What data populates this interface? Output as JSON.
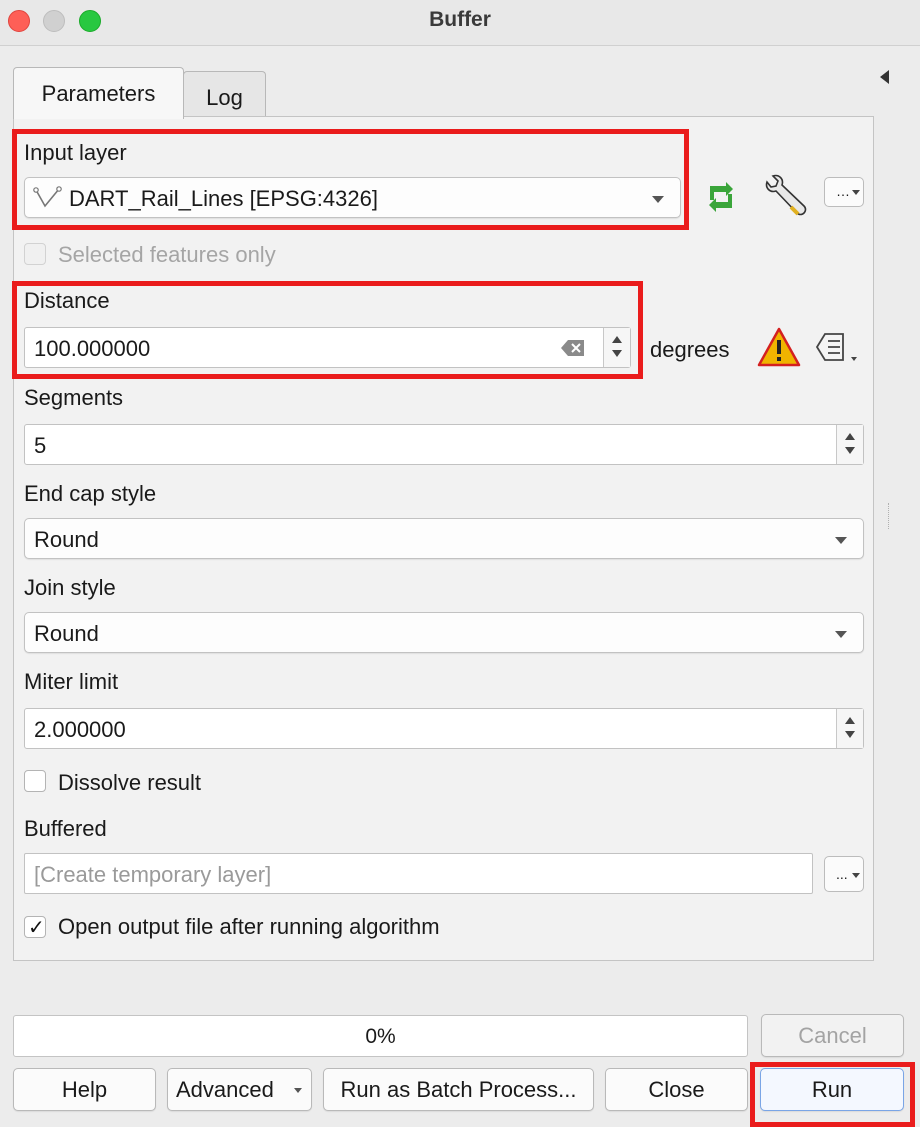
{
  "window": {
    "title": "Buffer"
  },
  "tabs": [
    {
      "label": "Parameters"
    },
    {
      "label": "Log"
    }
  ],
  "params": {
    "input_layer": {
      "label": "Input layer",
      "value": "DART_Rail_Lines [EPSG:4326]"
    },
    "selected_only": {
      "label": "Selected features only",
      "checked": false
    },
    "distance": {
      "label": "Distance",
      "value": "100.000000",
      "unit": "degrees"
    },
    "segments": {
      "label": "Segments",
      "value": "5"
    },
    "end_cap": {
      "label": "End cap style",
      "value": "Round"
    },
    "join_style": {
      "label": "Join style",
      "value": "Round"
    },
    "miter": {
      "label": "Miter limit",
      "value": "2.000000"
    },
    "dissolve": {
      "label": "Dissolve result",
      "checked": false
    },
    "output": {
      "label": "Buffered",
      "placeholder": "[Create temporary layer]",
      "more": "..."
    },
    "open_output": {
      "label": "Open output file after running algorithm",
      "checked": true
    }
  },
  "icons": {
    "line_layer": "line-geometry-icon",
    "iterate": "iterate-icon",
    "settings": "wrench-icon",
    "warning": "warning-icon",
    "data_defined": "data-defined-icon"
  },
  "progress": {
    "text": "0%",
    "value": 0
  },
  "buttons": {
    "cancel": "Cancel",
    "help": "Help",
    "advanced": "Advanced",
    "batch": "Run as Batch Process...",
    "close": "Close",
    "run": "Run"
  },
  "colors": {
    "highlight": "#ea1c1c",
    "iterate_green": "#3aa53a",
    "warning": "#f0b400"
  }
}
